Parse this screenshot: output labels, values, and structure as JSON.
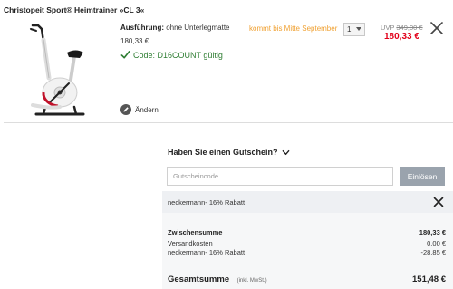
{
  "product": {
    "title": "Christopeit Sport® Heimtrainer »CL 3«",
    "spec_label": "Ausführung:",
    "spec_value": "ohne Unterlegmatte",
    "item_price": "180,33 €",
    "code_text": "Code: D16COUNT gültig",
    "delivery": "kommt bis Mitte September",
    "quantity": "1",
    "uvp_label": "UVP",
    "uvp_price": "349,00 €",
    "sale_price": "180,33 €",
    "edit_label": "Ändern"
  },
  "voucher": {
    "title": "Haben Sie einen Gutschein?",
    "placeholder": "Gutscheincode",
    "redeem_label": "Einlösen",
    "applied_text": "neckermann- 16% Rabatt"
  },
  "summary": {
    "subtotal_label": "Zwischensumme",
    "subtotal_value": "180,33 €",
    "shipping_label": "Versandkosten",
    "shipping_value": "0,00 €",
    "discount_label": "neckermann- 16% Rabatt",
    "discount_value": "-28,85 €",
    "total_label": "Gesamtsumme",
    "total_note": "(inkl. MwSt.)",
    "total_value": "151,48 €"
  },
  "colors": {
    "sale_red": "#e2001a",
    "valid_green": "#2e7d32",
    "delivery_orange": "#f0a030",
    "button_grey": "#9aa3ad"
  },
  "icons": {
    "check": "check-icon",
    "remove": "close-icon",
    "edit": "pencil-icon",
    "voucher_toggle": "chevron-down-icon"
  }
}
